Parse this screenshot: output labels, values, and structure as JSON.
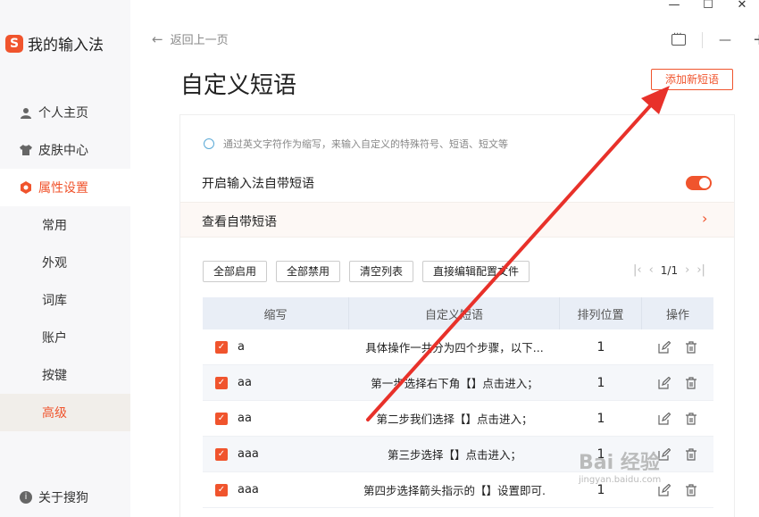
{
  "window": {
    "controls": [
      "—",
      "☐",
      "✕"
    ]
  },
  "sidebar": {
    "logo_text": "我的输入法",
    "items": [
      {
        "label": "个人主页"
      },
      {
        "label": "皮肤中心"
      },
      {
        "label": "属性设置"
      },
      {
        "label": "常用"
      },
      {
        "label": "外观"
      },
      {
        "label": "词库"
      },
      {
        "label": "账户"
      },
      {
        "label": "按键"
      },
      {
        "label": "高级"
      }
    ],
    "about": "关于搜狗"
  },
  "header": {
    "back_label": "返回上一页"
  },
  "page": {
    "title": "自定义短语",
    "add_button": "添加新短语",
    "hint": "通过英文字符作为缩写，来输入自定义的特殊符号、短语、短文等",
    "enable_label": "开启输入法自带短语",
    "enable_on": true,
    "view_label": "查看自带短语",
    "actions": [
      "全部启用",
      "全部禁用",
      "清空列表",
      "直接编辑配置文件"
    ],
    "pager": "1/1"
  },
  "table": {
    "headers": [
      "缩写",
      "自定义短语",
      "排列位置",
      "操作"
    ],
    "rows": [
      {
        "abbr": "a",
        "phrase": "具体操作一共分为四个步骤，以下...",
        "pos": "1"
      },
      {
        "abbr": "aa",
        "phrase": "第一步选择右下角【】点击进入；",
        "pos": "1"
      },
      {
        "abbr": "aa",
        "phrase": "第二步我们选择【】点击进入；",
        "pos": "1"
      },
      {
        "abbr": "aaa",
        "phrase": "第三步选择【】点击进入；",
        "pos": "1"
      },
      {
        "abbr": "aaa",
        "phrase": "第四步选择箭头指示的【】设置即可.",
        "pos": "1"
      }
    ]
  },
  "watermark": {
    "main": "Bai 经验",
    "sub": "jingyan.baidu.com"
  },
  "colors": {
    "accent": "#f0542d",
    "annotation_arrow": "#e8312a"
  }
}
